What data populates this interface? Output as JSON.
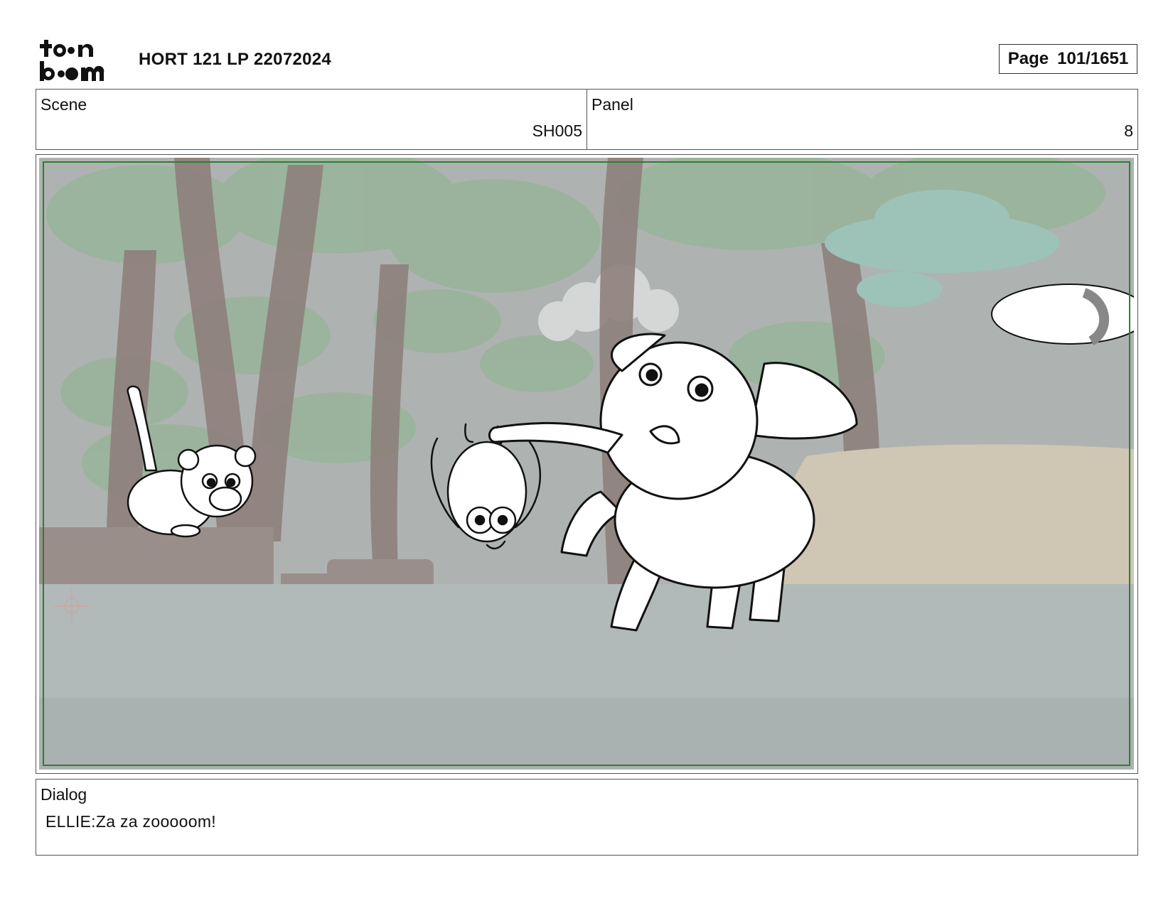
{
  "header": {
    "logo_text": "toon boom",
    "title": "HORT 121 LP 22072024",
    "page_label": "Page",
    "page_value": "101/1651"
  },
  "info": {
    "scene_label": "Scene",
    "scene_value": "SH005",
    "panel_label": "Panel",
    "panel_value": "8"
  },
  "dialog": {
    "label": "Dialog",
    "text": "ELLIE:Za za zooooom!"
  },
  "colors": {
    "safe_frame": "#2e7d32",
    "background_gray": "#b3b8b6",
    "foliage": "#8fae8f",
    "trunk": "#8b7d7a",
    "mushroom_teal": "#9cc2b8"
  }
}
